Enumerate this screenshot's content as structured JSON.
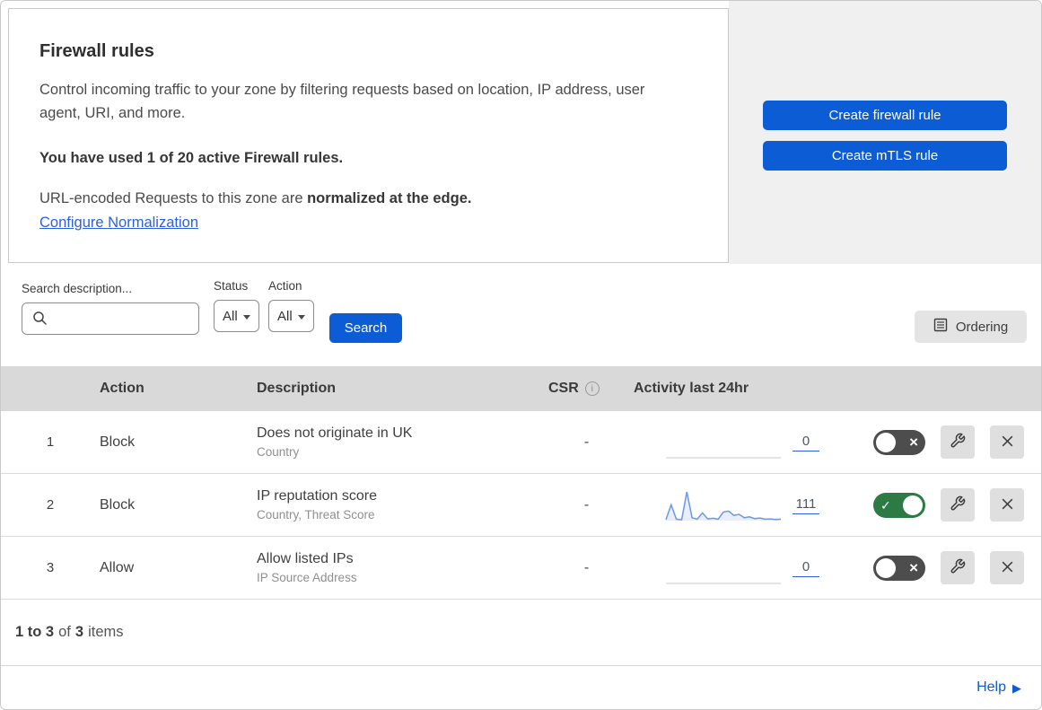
{
  "card": {
    "title": "Firewall rules",
    "description": "Control incoming traffic to your zone by filtering requests based on location, IP address, user agent, URI, and more.",
    "usage": "You have used 1 of 20 active Firewall rules.",
    "normalization_prefix": "URL-encoded Requests to this zone are ",
    "normalization_bold": "normalized at the edge.",
    "normalization_link": "Configure Normalization"
  },
  "actions_panel": {
    "create_firewall_label": "Create firewall rule",
    "create_mtls_label": "Create mTLS rule"
  },
  "filters": {
    "search_label": "Search description...",
    "search_value": "",
    "status_label": "Status",
    "status_value": "All",
    "action_label": "Action",
    "action_value": "All",
    "search_button": "Search",
    "ordering_button": "Ordering"
  },
  "table": {
    "headers": {
      "action": "Action",
      "description": "Description",
      "csr": "CSR",
      "csr_info": "i",
      "activity": "Activity last 24hr"
    },
    "rows": [
      {
        "priority": "1",
        "action": "Block",
        "description": "Does not originate in UK",
        "fields": "Country",
        "csr": "-",
        "activity_count": "0",
        "enabled": false,
        "spark": []
      },
      {
        "priority": "2",
        "action": "Block",
        "description": "IP reputation score",
        "fields": "Country, Threat Score",
        "csr": "-",
        "activity_count": "111",
        "enabled": true,
        "spark": [
          3,
          55,
          5,
          3,
          100,
          10,
          5,
          27,
          6,
          8,
          5,
          30,
          33,
          18,
          22,
          10,
          13,
          7,
          9,
          5,
          6,
          4,
          5
        ]
      },
      {
        "priority": "3",
        "action": "Allow",
        "description": "Allow listed IPs",
        "fields": "IP Source Address",
        "csr": "-",
        "activity_count": "0",
        "enabled": false,
        "spark": []
      }
    ]
  },
  "footer": {
    "range": "1 to 3",
    "of": "of",
    "total": "3",
    "items": "items"
  },
  "help": {
    "label": "Help"
  },
  "colors": {
    "primary_blue": "#0b5cd5",
    "link_blue": "#2b62d9",
    "toggle_green": "#2c7a44",
    "toggle_off_gray": "#4d4d4d",
    "spark_line_blue": "#6e96e6",
    "table_header_gray": "#d9d9d9",
    "side_panel_gray": "#f0f0f0"
  }
}
